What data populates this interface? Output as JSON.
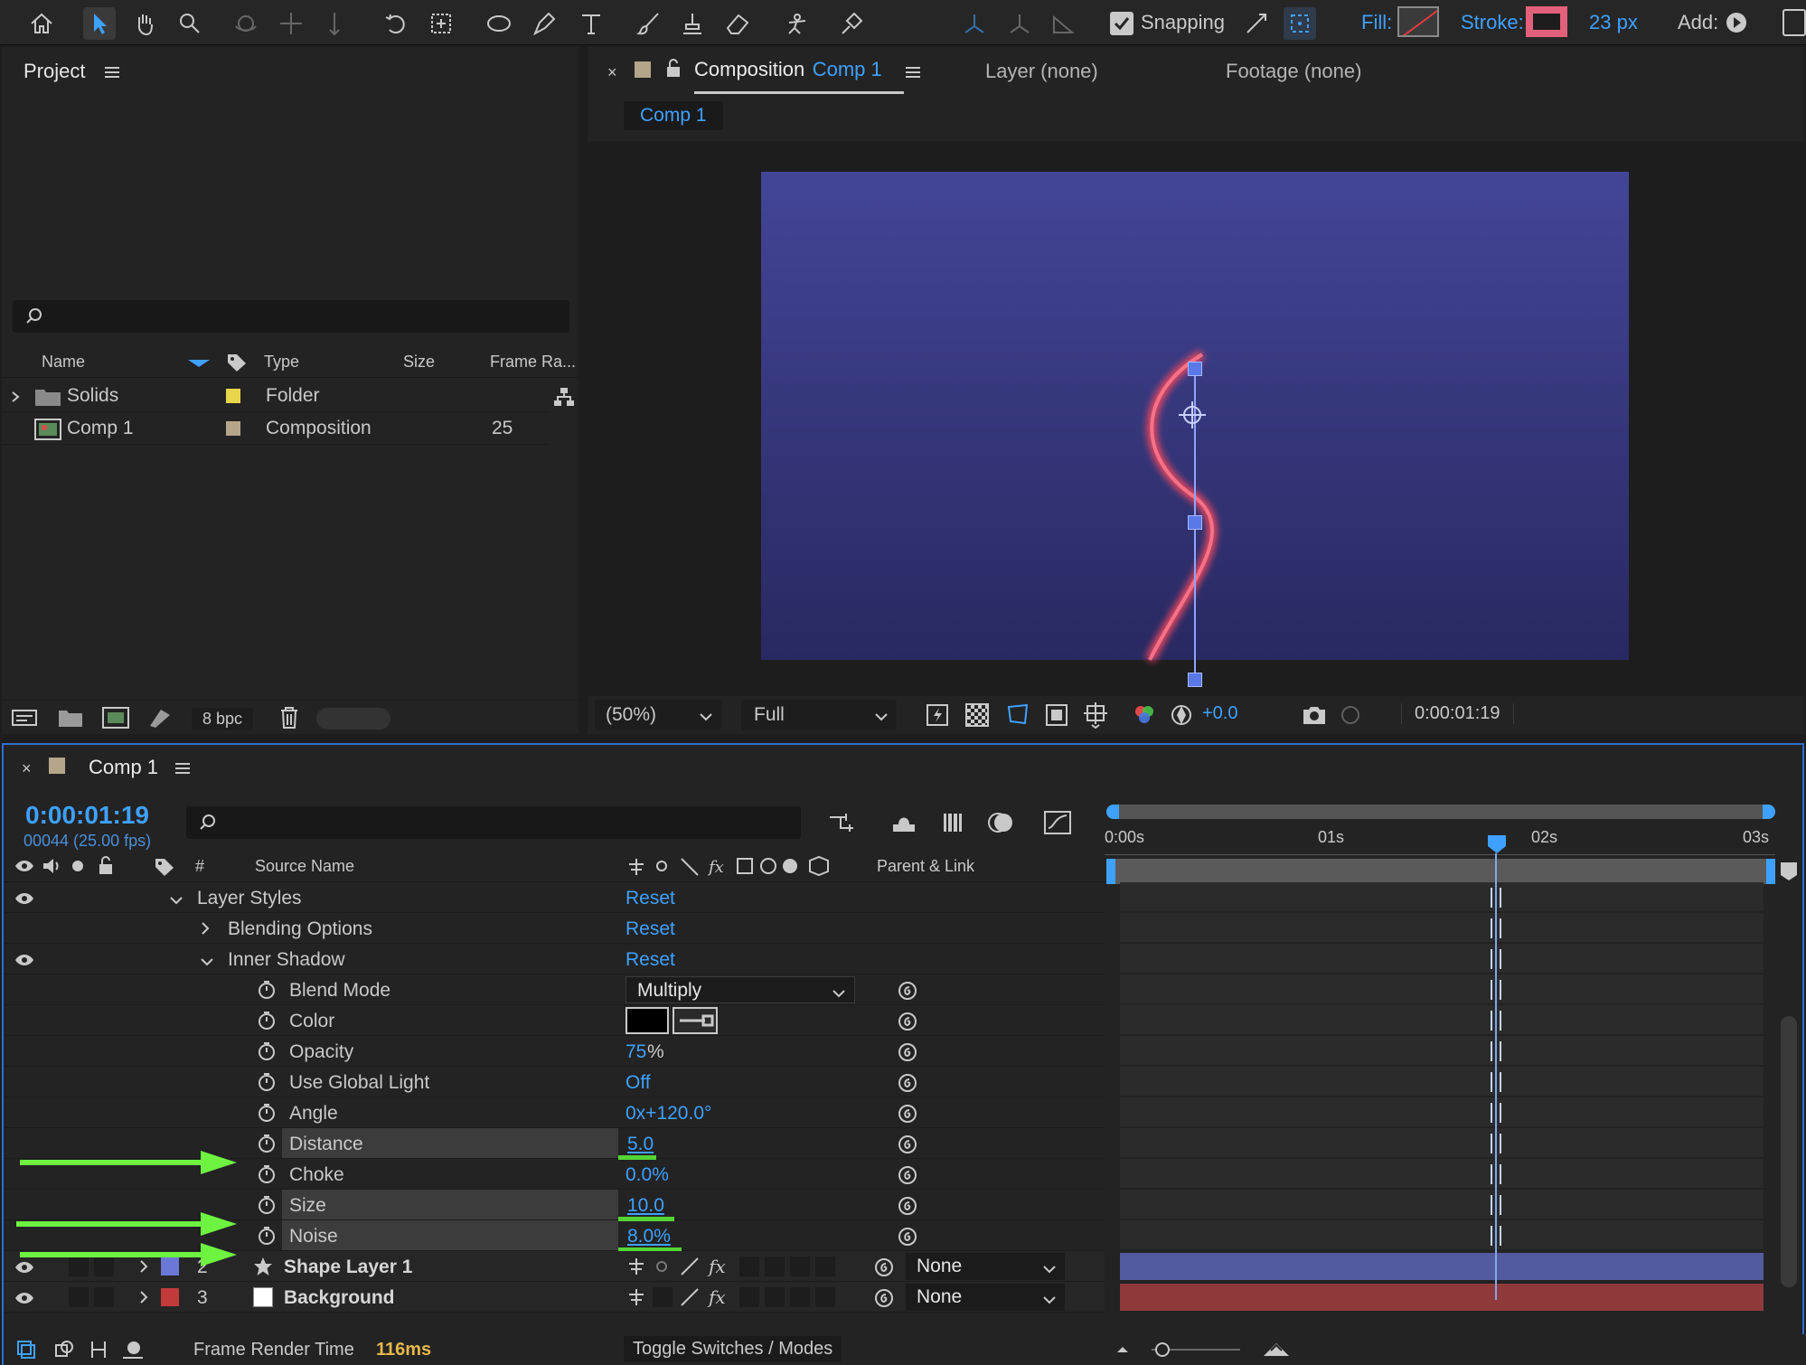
{
  "toolbar": {
    "snapping_label": "Snapping",
    "fill_label": "Fill:",
    "stroke_label": "Stroke:",
    "stroke_width": "23 px",
    "add_label": "Add:"
  },
  "project": {
    "title": "Project",
    "search_placeholder": "",
    "columns": {
      "name": "Name",
      "type": "Type",
      "size": "Size",
      "frame_rate": "Frame Ra..."
    },
    "items": [
      {
        "name": "Solids",
        "type": "Folder",
        "size": "",
        "frame_rate": "",
        "label_color": "#e8d64a"
      },
      {
        "name": "Comp 1",
        "type": "Composition",
        "size": "",
        "frame_rate": "25",
        "label_color": "#b5a58a"
      }
    ],
    "bpc": "8 bpc"
  },
  "composition": {
    "tab_label_prefix": "Composition",
    "tab_label_name": "Comp 1",
    "layer_tab": "Layer (none)",
    "footage_tab": "Footage (none)",
    "breadcrumb": "Comp 1",
    "zoom": "(50%)",
    "resolution": "Full",
    "exposure": "+0.0",
    "timecode": "0:00:01:19"
  },
  "timeline": {
    "title": "Comp 1",
    "timecode": "0:00:01:19",
    "frame_info": "00044 (25.00 fps)",
    "col_number": "#",
    "col_source": "Source Name",
    "col_parent": "Parent & Link",
    "ruler": [
      "0:00s",
      "01s",
      "02s",
      "03s"
    ],
    "properties": [
      {
        "label": "Layer Styles",
        "value": "Reset",
        "indent": 0,
        "twirl": "open",
        "eye": true
      },
      {
        "label": "Blending Options",
        "value": "Reset",
        "indent": 1,
        "twirl": "closed",
        "eye": false
      },
      {
        "label": "Inner Shadow",
        "value": "Reset",
        "indent": 1,
        "twirl": "open",
        "eye": true
      },
      {
        "label": "Blend Mode",
        "value": "Multiply",
        "indent": 2,
        "kind": "dropdown"
      },
      {
        "label": "Color",
        "value": "",
        "indent": 2,
        "kind": "color"
      },
      {
        "label": "Opacity",
        "value": "75",
        "unit": "%",
        "indent": 2
      },
      {
        "label": "Use Global Light",
        "value": "Off",
        "indent": 2
      },
      {
        "label": "Angle",
        "value": "0x+120.0°",
        "indent": 2
      },
      {
        "label": "Distance",
        "value": "5.0",
        "indent": 2,
        "highlight": true
      },
      {
        "label": "Choke",
        "value": "0.0%",
        "indent": 2
      },
      {
        "label": "Size",
        "value": "10.0",
        "indent": 2,
        "highlight": true
      },
      {
        "label": "Noise",
        "value": "8.0%",
        "indent": 2,
        "highlight": true
      }
    ],
    "layers": [
      {
        "number": "2",
        "name": "Shape Layer 1",
        "parent": "None",
        "label_color": "#6b78d8",
        "bar_color": "#545a9f"
      },
      {
        "number": "3",
        "name": "Background",
        "parent": "None",
        "label_color": "#c33a3a",
        "bar_color": "#8f3a3a"
      }
    ],
    "render_label": "Frame Render Time",
    "render_value": "116ms",
    "toggle_label": "Toggle Switches / Modes"
  }
}
